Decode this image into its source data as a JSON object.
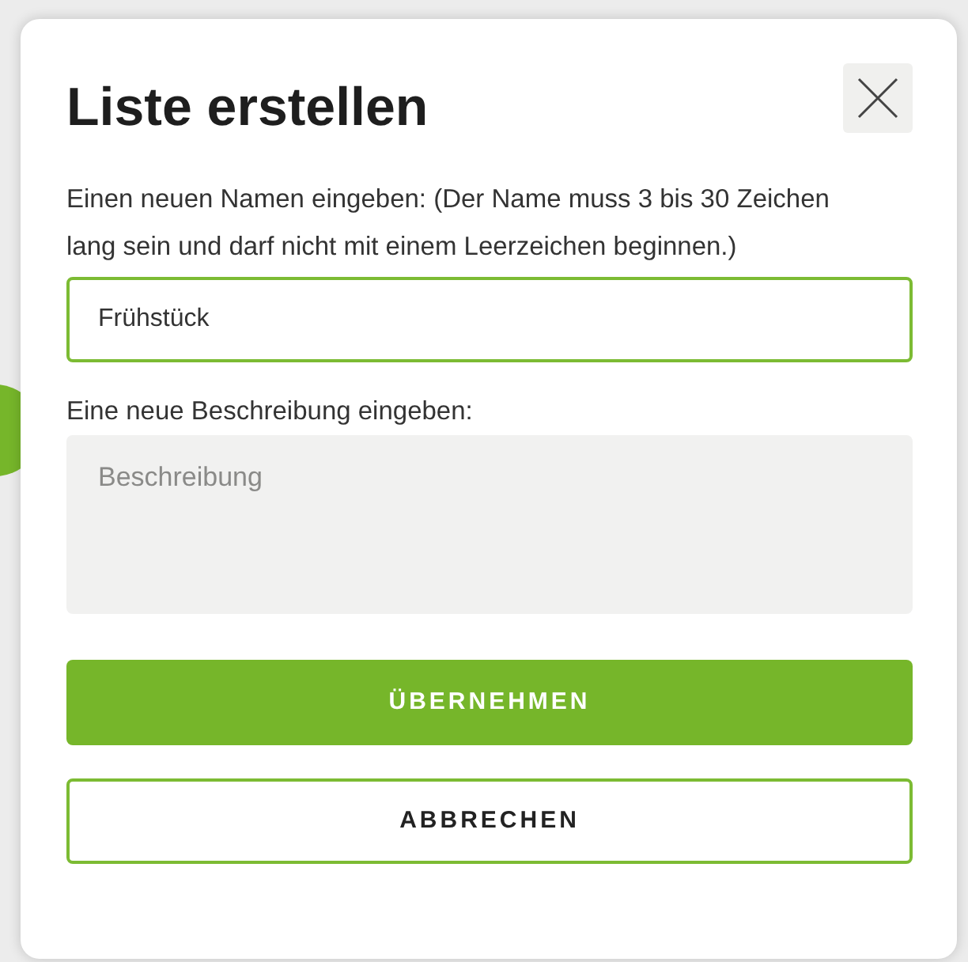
{
  "dialog": {
    "title": "Liste erstellen",
    "name_field": {
      "label": "Einen neuen Namen eingeben: (Der Name muss 3 bis 30 Zeichen lang sein und darf nicht mit einem Leerzeichen beginnen.)",
      "value": "Frühstück"
    },
    "description_field": {
      "label": "Eine neue Beschreibung eingeben:",
      "placeholder": "Beschreibung"
    },
    "buttons": [
      {
        "label": "ÜBERNEHMEN",
        "kind": "primary"
      },
      {
        "label": "ABBRECHEN",
        "kind": "secondary"
      }
    ]
  }
}
